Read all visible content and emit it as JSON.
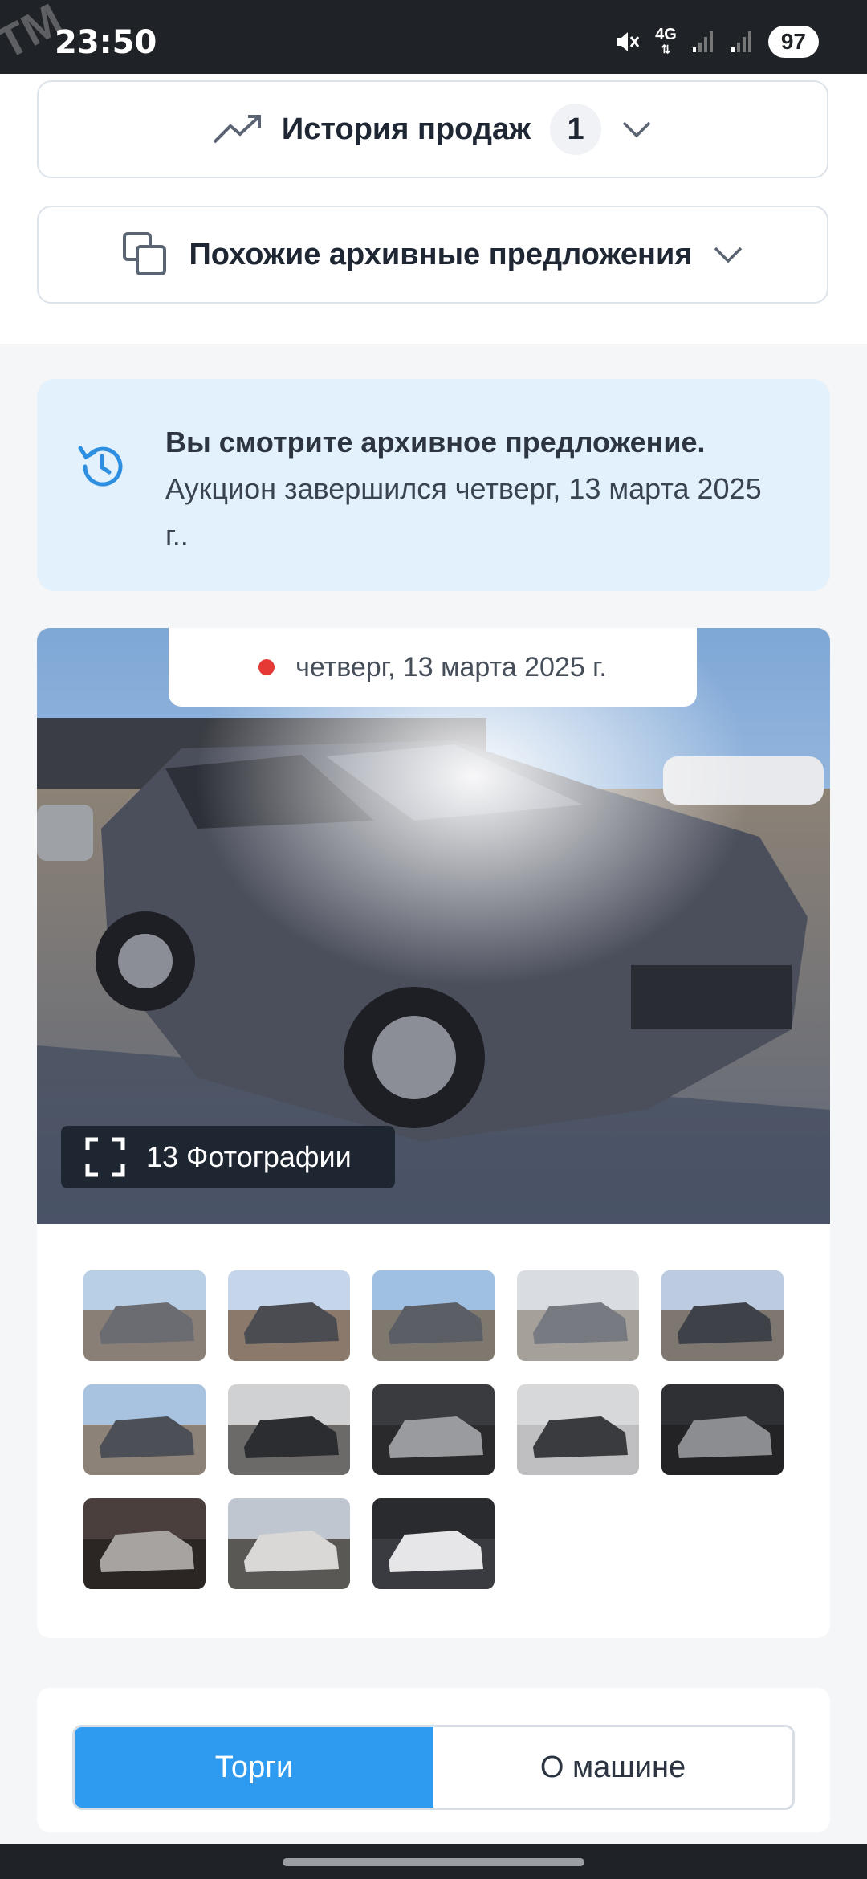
{
  "status_bar": {
    "time": "23:50",
    "network": "4G",
    "battery": "97",
    "watermark": "TM"
  },
  "sections": {
    "sales_history": {
      "label": "История продаж",
      "count": "1"
    },
    "similar_offers": {
      "label": "Похожие архивные предложения"
    }
  },
  "archive_notice": {
    "title": "Вы смотрите архивное предложение.",
    "message": "Аукцион завершился четверг, 13 марта 2025 г.."
  },
  "gallery": {
    "auction_date": "четверг, 13 марта 2025 г.",
    "photo_count_label": "13 Фотографии",
    "thumbnails": [
      {
        "name": "thumb-1",
        "sky": "#b9cfe6",
        "ground": "#8a7f76",
        "car": "#6b6c72"
      },
      {
        "name": "thumb-2",
        "sky": "#c5d6ea",
        "ground": "#8b7a6c",
        "car": "#4a4c52"
      },
      {
        "name": "thumb-3",
        "sky": "#9fc0e3",
        "ground": "#7f786f",
        "car": "#5c5e66"
      },
      {
        "name": "thumb-4",
        "sky": "#d9dde2",
        "ground": "#a6a09a",
        "car": "#777a80"
      },
      {
        "name": "thumb-5",
        "sky": "#bccbe0",
        "ground": "#7d7770",
        "car": "#3f4148"
      },
      {
        "name": "thumb-6",
        "sky": "#a8c3e0",
        "ground": "#8d8278",
        "car": "#4d4f56"
      },
      {
        "name": "thumb-7",
        "sky": "#cfd1d3",
        "ground": "#6c6a68",
        "car": "#2c2d30"
      },
      {
        "name": "thumb-8",
        "sky": "#3a3b3e",
        "ground": "#2a2a2c",
        "car": "#9a9b9e"
      },
      {
        "name": "thumb-9",
        "sky": "#d7d8da",
        "ground": "#bfbfc2",
        "car": "#3a3b3f"
      },
      {
        "name": "thumb-10",
        "sky": "#2f3033",
        "ground": "#232325",
        "car": "#8c8d90"
      },
      {
        "name": "thumb-11",
        "sky": "#4a3f3c",
        "ground": "#2b2524",
        "car": "#a6a3a1"
      },
      {
        "name": "thumb-12",
        "sky": "#bfc6cf",
        "ground": "#5a5855",
        "car": "#d9d8d6"
      },
      {
        "name": "thumb-13",
        "sky": "#2a2b2f",
        "ground": "#3a3b40",
        "car": "#e6e6e8"
      }
    ]
  },
  "tabs": [
    {
      "label": "Торги",
      "active": true
    },
    {
      "label": "О машине",
      "active": false
    }
  ]
}
